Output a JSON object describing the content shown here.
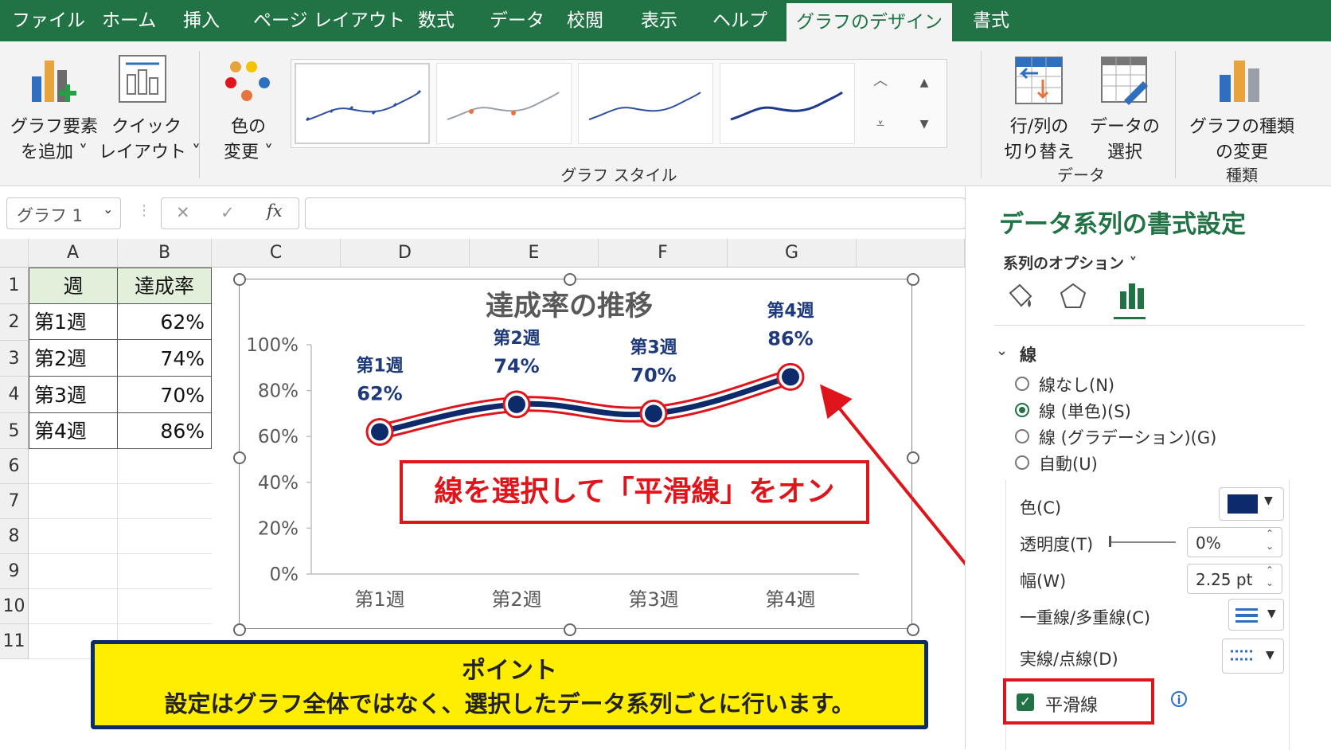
{
  "tabs": [
    "ファイル",
    "ホーム",
    "挿入",
    "ページ レイアウト",
    "数式",
    "データ",
    "校閲",
    "表示",
    "ヘルプ",
    "グラフのデザイン",
    "書式"
  ],
  "active_tab": "グラフのデザイン",
  "ribbon": {
    "add_element": [
      "グラフ要素",
      "を追加 ˅"
    ],
    "quick_layout": [
      "クイック",
      "レイアウト ˅"
    ],
    "change_color": [
      "色の",
      "変更 ˅"
    ],
    "styles_group": "グラフ スタイル",
    "switch_rowcol": [
      "行/列の",
      "切り替え"
    ],
    "select_data": [
      "データの",
      "選択"
    ],
    "data_group": "データ",
    "change_type": [
      "グラフの種類",
      "の変更"
    ],
    "type_group": "種類"
  },
  "formula_bar": {
    "name_box": "グラフ 1",
    "fx": "fx",
    "cancel": "✕",
    "enter": "✓"
  },
  "columns": [
    "A",
    "B",
    "C",
    "D",
    "E",
    "F",
    "G"
  ],
  "rows": [
    "1",
    "2",
    "3",
    "4",
    "5",
    "6",
    "7",
    "8",
    "9",
    "10",
    "11"
  ],
  "table": {
    "header": [
      "週",
      "達成率"
    ],
    "rows": [
      [
        "第1週",
        "62%"
      ],
      [
        "第2週",
        "74%"
      ],
      [
        "第3週",
        "70%"
      ],
      [
        "第4週",
        "86%"
      ]
    ]
  },
  "chart_data": {
    "type": "line",
    "title": "達成率の推移",
    "categories": [
      "第1週",
      "第2週",
      "第3週",
      "第4週"
    ],
    "values": [
      62,
      74,
      70,
      86
    ],
    "point_labels": [
      [
        "第1週",
        "62%"
      ],
      [
        "第2週",
        "74%"
      ],
      [
        "第3週",
        "70%"
      ],
      [
        "第4週",
        "86%"
      ]
    ],
    "yticks": [
      "0%",
      "20%",
      "40%",
      "60%",
      "80%",
      "100%"
    ],
    "ylim": [
      0,
      100
    ],
    "smooth": true,
    "line_color": "#0d2a6b",
    "highlight_color": "#e0141b",
    "grid": false
  },
  "callout": "線を選択して「平滑線」をオン",
  "point_box": {
    "title": "ポイント",
    "text": "設定はグラフ全体ではなく、選択したデータ系列ごとに行います。"
  },
  "pane": {
    "title": "データ系列の書式設定",
    "series_options": "系列のオプション ˅",
    "section": "線",
    "radios": [
      {
        "label": "線なし(N)",
        "on": false
      },
      {
        "label": "線 (単色)(S)",
        "on": true
      },
      {
        "label": "線 (グラデーション)(G)",
        "on": false
      },
      {
        "label": "自動(U)",
        "on": false
      }
    ],
    "color_label": "色(C)",
    "color_value": "#0d2a6b",
    "transparency_label": "透明度(T)",
    "transparency_value": "0%",
    "width_label": "幅(W)",
    "width_value": "2.25 pt",
    "compound_label": "一重線/多重線(C)",
    "dash_label": "実線/点線(D)",
    "smooth_label": "平滑線",
    "smooth_checked": true
  }
}
